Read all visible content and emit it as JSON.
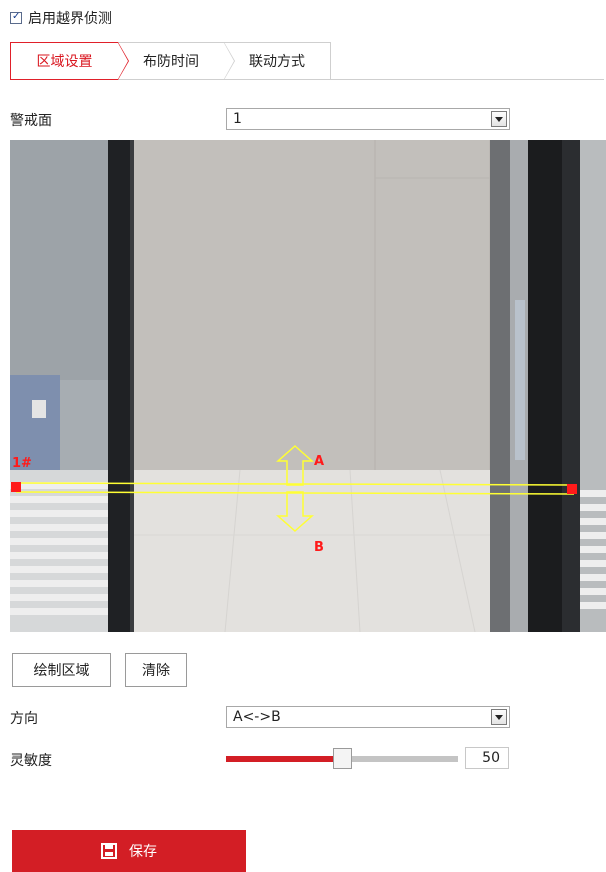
{
  "enable": {
    "label": "启用越界侦测",
    "checked": true
  },
  "tabs": [
    {
      "label": "区域设置",
      "active": true
    },
    {
      "label": "布防时间",
      "active": false
    },
    {
      "label": "联动方式",
      "active": false
    }
  ],
  "warning_plane": {
    "label": "警戒面",
    "value": "1"
  },
  "overlay": {
    "line_id": "1#",
    "side_a": "A",
    "side_b": "B"
  },
  "buttons": {
    "draw": "绘制区域",
    "clear": "清除"
  },
  "direction": {
    "label": "方向",
    "value": "A<->B"
  },
  "sensitivity": {
    "label": "灵敏度",
    "value": "50",
    "level": 0.5
  },
  "save": {
    "label": "保存",
    "icon": "save-icon"
  },
  "colors": {
    "accent": "#d31e25",
    "line": "#ffff33",
    "endpoint": "#ff1a1a"
  }
}
